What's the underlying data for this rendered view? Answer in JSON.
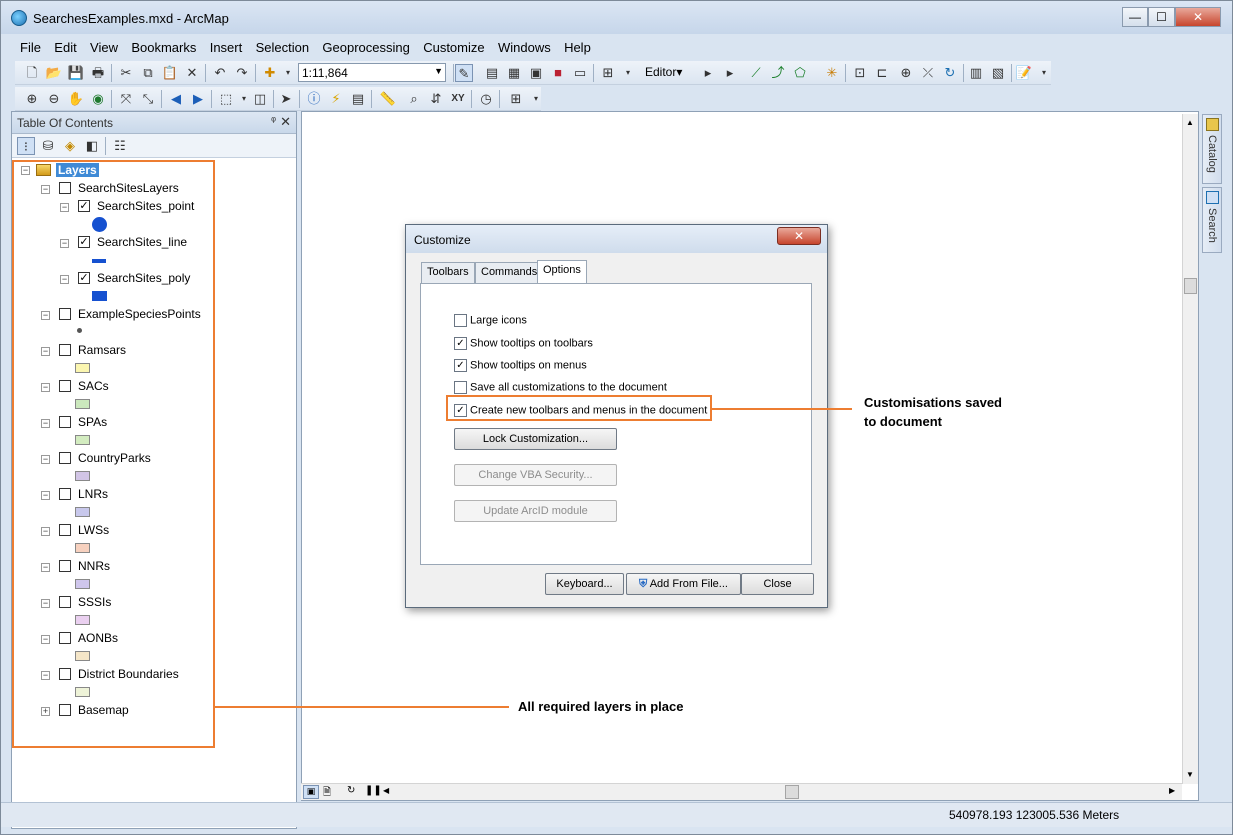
{
  "window": {
    "title": "SearchesExamples.mxd - ArcMap",
    "min": "—",
    "max": "☐",
    "close": "✕"
  },
  "menu": [
    "File",
    "Edit",
    "View",
    "Bookmarks",
    "Insert",
    "Selection",
    "Geoprocessing",
    "Customize",
    "Windows",
    "Help"
  ],
  "toolbar": {
    "scale": "1:11,864",
    "editor": "Editor▾"
  },
  "toc": {
    "title": "Table Of Contents",
    "pin": "ᵠ",
    "close": "✕",
    "root": "Layers",
    "group": "SearchSitesLayers",
    "sublayers": [
      {
        "name": "SearchSites_point",
        "checked": "✓"
      },
      {
        "name": "SearchSites_line",
        "checked": "✓"
      },
      {
        "name": "SearchSites_poly",
        "checked": "✓"
      }
    ],
    "layers": [
      "ExampleSpeciesPoints",
      "Ramsars",
      "SACs",
      "SPAs",
      "CountryParks",
      "LNRs",
      "LWSs",
      "NNRs",
      "SSSIs",
      "AONBs",
      "District Boundaries",
      "Basemap"
    ],
    "colors": {
      "Ramsars": "#fbf6b0",
      "SACs": "#cbe8bd",
      "SPAs": "#d3ecc0",
      "CountryParks": "#d2c5e6",
      "LNRs": "#c8c8ec",
      "LWSs": "#f7d1bf",
      "NNRs": "#cfc6ec",
      "SSSIs": "#ead0f0",
      "AONBs": "#f5e6c8",
      "District Boundaries": "#eef3d8"
    },
    "symbol_blue": "#1651d0"
  },
  "side_tabs": {
    "catalog": "Catalog",
    "search": "Search"
  },
  "status": {
    "coords": "540978.193  123005.536 Meters"
  },
  "dialog": {
    "title": "Customize",
    "close": "✕",
    "tabs": [
      "Toolbars",
      "Commands",
      "Options"
    ],
    "options": [
      {
        "label": "Large icons",
        "checked": ""
      },
      {
        "label": "Show tooltips on toolbars",
        "checked": "✓"
      },
      {
        "label": "Show tooltips on menus",
        "checked": "✓"
      },
      {
        "label": "Save all customizations to the document",
        "checked": ""
      },
      {
        "label": "Create new toolbars and menus in the document",
        "checked": "✓"
      }
    ],
    "buttons": {
      "lock": "Lock Customization...",
      "vba": "Change VBA Security...",
      "arcid": "Update ArcID module"
    },
    "footer": {
      "keyboard": "Keyboard...",
      "add_from_file": "Add From File...",
      "close": "Close"
    }
  },
  "annotations": {
    "dialog_callout_line1": "Customisations saved",
    "dialog_callout_line2": "to document",
    "layers_callout": "All required layers in place",
    "accent": "#ed7d31"
  }
}
